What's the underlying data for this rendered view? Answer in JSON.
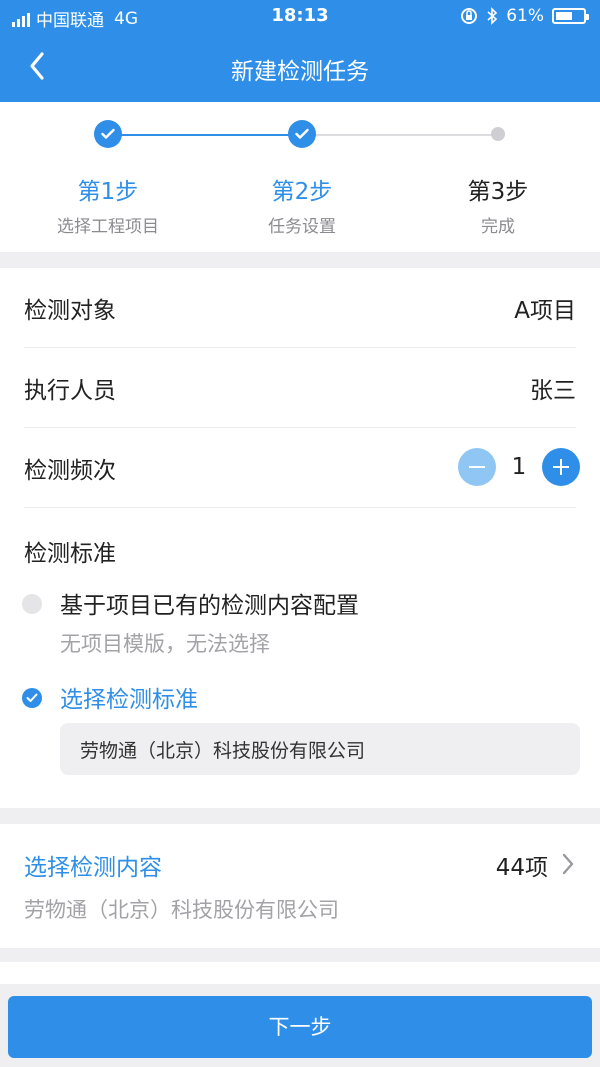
{
  "status_bar": {
    "carrier": "中国联通",
    "network": "4G",
    "time": "18:13",
    "battery": "61%",
    "battery_level": 0.61
  },
  "header": {
    "title": "新建检测任务",
    "back_icon": "chevron-left-icon"
  },
  "steps": [
    {
      "title": "第1步",
      "subtitle": "选择工程项目",
      "state": "done"
    },
    {
      "title": "第2步",
      "subtitle": "任务设置",
      "state": "done"
    },
    {
      "title": "第3步",
      "subtitle": "完成",
      "state": "pending"
    }
  ],
  "form": {
    "target": {
      "label": "检测对象",
      "value": "A项目"
    },
    "executor": {
      "label": "执行人员",
      "value": "张三"
    },
    "frequency": {
      "label": "检测频次",
      "value": "1"
    },
    "standard": {
      "label": "检测标准",
      "option_existing": {
        "title": "基于项目已有的检测内容配置",
        "subtitle": "无项目模版，无法选择",
        "selected": false
      },
      "option_select": {
        "title": "选择检测标准",
        "selected": true,
        "value": "劳物通（北京）科技股份有限公司"
      }
    }
  },
  "content": {
    "title": "选择检测内容",
    "count": "44项",
    "subtitle": "劳物通（北京）科技股份有限公司"
  },
  "next_button": "下一步",
  "colors": {
    "primary": "#2f8fe8",
    "minus_button": "#8fc6f3",
    "background": "#efeff1"
  }
}
